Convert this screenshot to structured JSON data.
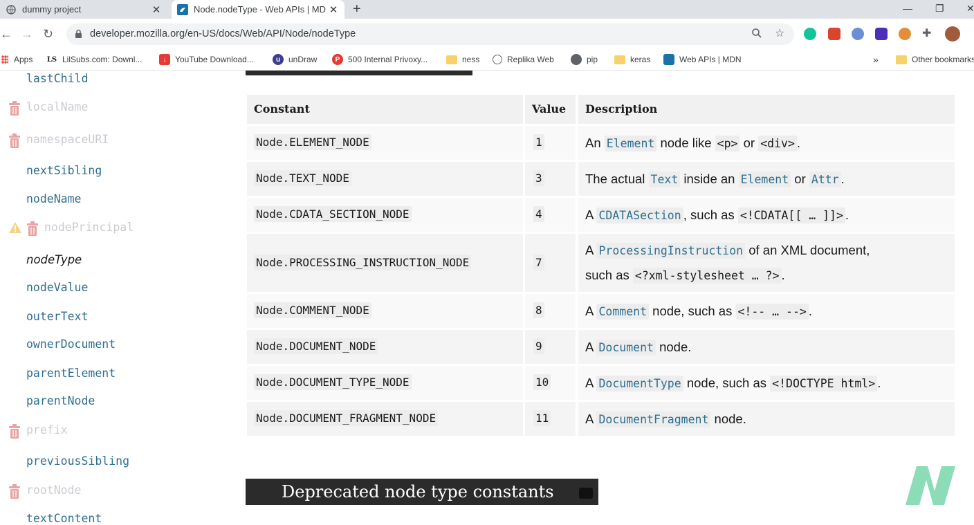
{
  "browser": {
    "tabs": [
      {
        "title": "dummy project",
        "close": "✕"
      },
      {
        "title": "Node.nodeType - Web APIs | MDN",
        "close": "✕"
      }
    ],
    "new_tab": "+",
    "url": "developer.mozilla.org/en-US/docs/Web/API/Node/nodeType",
    "bookmarks": [
      {
        "label": "Apps"
      },
      {
        "label": "LilSubs.com: Downl..."
      },
      {
        "label": "YouTube Download..."
      },
      {
        "label": "unDraw"
      },
      {
        "label": "500 Internal Privoxy..."
      },
      {
        "label": "ness"
      },
      {
        "label": "Replika Web"
      },
      {
        "label": "pip"
      },
      {
        "label": "keras"
      },
      {
        "label": "Web APIs | MDN"
      },
      {
        "label": "Other bookmarks"
      }
    ],
    "bookmarks_overflow": "»"
  },
  "sidebar": {
    "items": [
      {
        "label": "lastChild",
        "state": "normal"
      },
      {
        "label": "localName",
        "state": "deprecated"
      },
      {
        "label": "namespaceURI",
        "state": "deprecated"
      },
      {
        "label": "nextSibling",
        "state": "normal"
      },
      {
        "label": "nodeName",
        "state": "normal"
      },
      {
        "label": "nodePrincipal",
        "state": "deprecated-warning"
      },
      {
        "label": "nodeType",
        "state": "current"
      },
      {
        "label": "nodeValue",
        "state": "normal"
      },
      {
        "label": "outerText",
        "state": "normal"
      },
      {
        "label": "ownerDocument",
        "state": "normal"
      },
      {
        "label": "parentElement",
        "state": "normal"
      },
      {
        "label": "parentNode",
        "state": "normal"
      },
      {
        "label": "prefix",
        "state": "deprecated"
      },
      {
        "label": "previousSibling",
        "state": "normal"
      },
      {
        "label": "rootNode",
        "state": "deprecated"
      },
      {
        "label": "textContent",
        "state": "normal"
      }
    ]
  },
  "table": {
    "headers": {
      "constant": "Constant",
      "value": "Value",
      "description": "Description"
    },
    "rows": [
      {
        "constant": "Node.ELEMENT_NODE",
        "value": "1"
      },
      {
        "constant": "Node.TEXT_NODE",
        "value": "3"
      },
      {
        "constant": "Node.CDATA_SECTION_NODE",
        "value": "4"
      },
      {
        "constant": "Node.PROCESSING_INSTRUCTION_NODE",
        "value": "7"
      },
      {
        "constant": "Node.COMMENT_NODE",
        "value": "8"
      },
      {
        "constant": "Node.DOCUMENT_NODE",
        "value": "9"
      },
      {
        "constant": "Node.DOCUMENT_TYPE_NODE",
        "value": "10"
      },
      {
        "constant": "Node.DOCUMENT_FRAGMENT_NODE",
        "value": "11"
      }
    ],
    "desc": {
      "r0": {
        "a": "An ",
        "link1": "Element",
        "b": " node like ",
        "code1": "<p>",
        "c": " or ",
        "code2": "<div>",
        "d": "."
      },
      "r1": {
        "a": "The actual ",
        "link1": "Text",
        "b": " inside an ",
        "link2": "Element",
        "c": " or ",
        "link3": "Attr",
        "d": "."
      },
      "r2": {
        "a": "A ",
        "link1": "CDATASection",
        "b": ", such as ",
        "code1": "<!CDATA[[ … ]]>",
        "c": "."
      },
      "r3": {
        "a": "A ",
        "link1": "ProcessingInstruction",
        "b": " of an XML document,",
        "c": "such as ",
        "code1": "<?xml-stylesheet … ?>",
        "d": "."
      },
      "r4": {
        "a": "A ",
        "link1": "Comment",
        "b": " node, such as ",
        "code1": "<!-- … -->",
        "c": "."
      },
      "r5": {
        "a": "A ",
        "link1": "Document",
        "b": " node."
      },
      "r6": {
        "a": "A ",
        "link1": "DocumentType",
        "b": " node, such as ",
        "code1": "<!DOCTYPE html>",
        "c": "."
      },
      "r7": {
        "a": "A ",
        "link1": "DocumentFragment",
        "b": " node."
      }
    }
  },
  "section_heading": "Deprecated node type constants",
  "colors": {
    "link": "#2f6f8f",
    "heading_bg": "#2b2b2b",
    "deprecated": "#c9ccd1",
    "trash": "#e8a3a3",
    "logo": "#7fd8b0"
  }
}
